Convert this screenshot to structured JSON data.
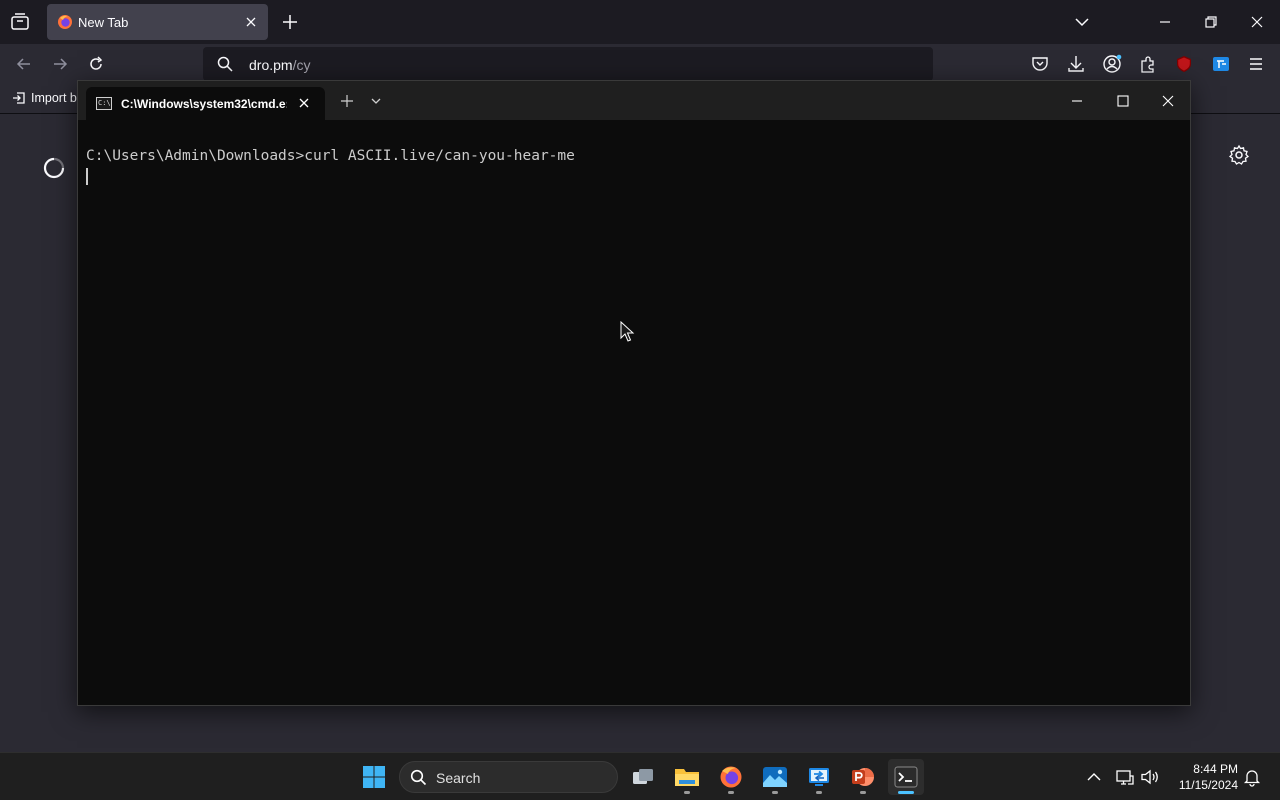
{
  "browser": {
    "tab": {
      "title": "New Tab"
    },
    "urlbar": {
      "host": "dro.pm",
      "path": "/cy"
    },
    "bookmarks": {
      "import_label": "Import b"
    }
  },
  "terminal": {
    "tab_title": "C:\\Windows\\system32\\cmd.e:",
    "icon_text": "C:\\",
    "prompt_line": "C:\\Users\\Admin\\Downloads>curl ASCII.live/can-you-hear-me"
  },
  "taskbar": {
    "search_label": "Search",
    "clock": {
      "time": "8:44 PM",
      "date": "11/15/2024"
    }
  },
  "colors": {
    "accent": "#4cc2ff",
    "terminal_bg": "#0c0c0c",
    "browser_bg": "#2b2a33"
  }
}
